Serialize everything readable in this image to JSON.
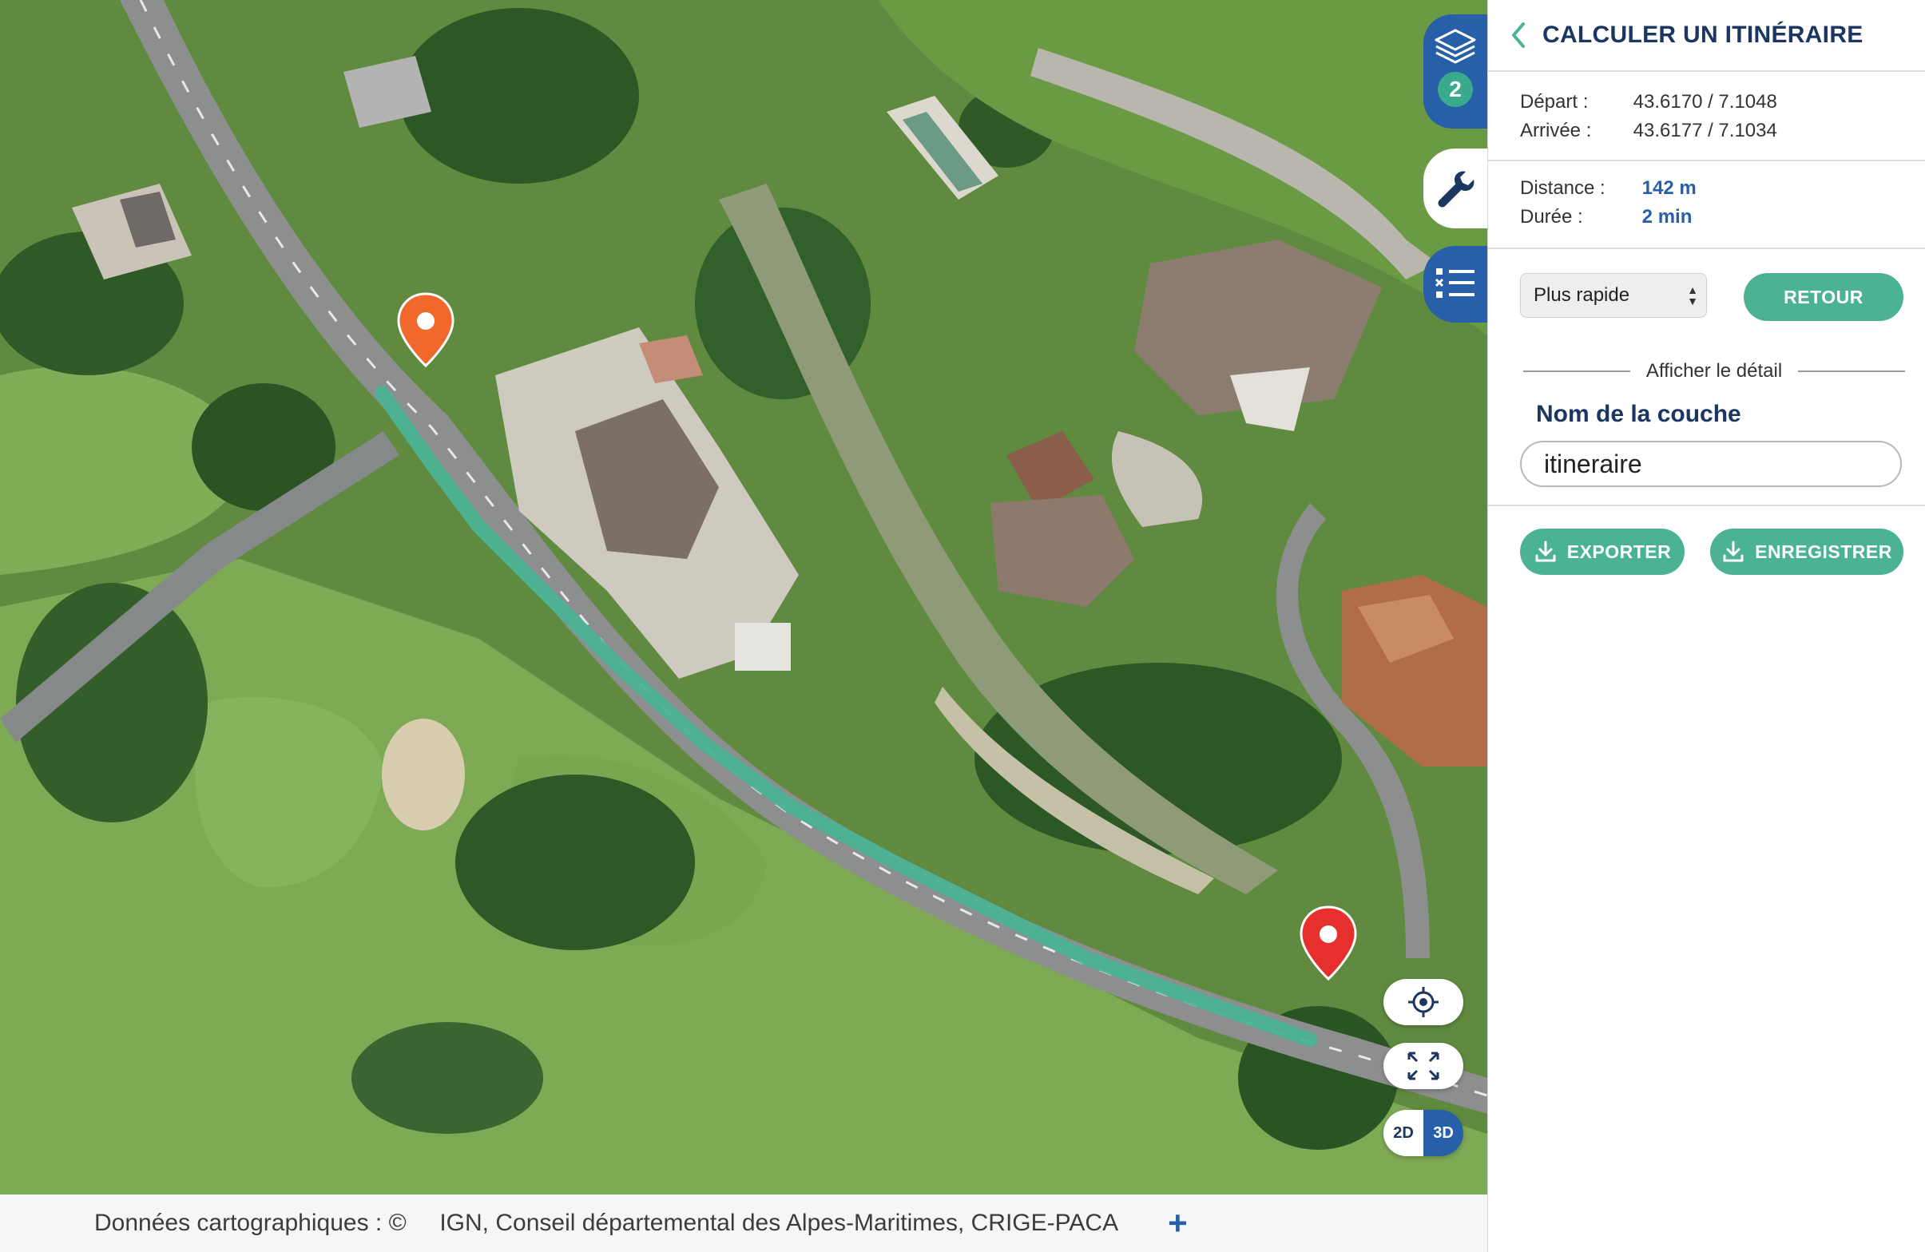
{
  "map": {
    "route_color": "#4bb394",
    "start_marker_icon": "map-pin-orange",
    "end_marker_icon": "map-pin-red"
  },
  "toolbar": {
    "layers_count": "2",
    "layers_icon": "layers-stack-icon",
    "tools_icon": "wrench-icon",
    "legend_icon": "legend-list-icon"
  },
  "controls": {
    "locate_icon": "crosshair-icon",
    "fullscreen_icon": "expand-arrows-icon",
    "dim_2d": "2D",
    "dim_3d": "3D",
    "active_dimension": "3D"
  },
  "attribution": {
    "text": "Données cartographiques : ©     IGN, Conseil départemental des Alpes-Maritimes, CRIGE-PACA",
    "plus": "+"
  },
  "panel": {
    "title": "CALCULER UN ITINÉRAIRE",
    "departure_label": "Départ :",
    "departure_value": "43.6170 / 7.1048",
    "arrival_label": "Arrivée :",
    "arrival_value": "43.6177 / 7.1034",
    "distance_label": "Distance :",
    "distance_value": "142 m",
    "duration_label": "Durée :",
    "duration_value": "2 min",
    "mode_select_value": "Plus rapide",
    "retour_button": "RETOUR",
    "detail_label": "Afficher le détail",
    "layer_name_label": "Nom de la couche",
    "layer_name_value": "itineraire",
    "export_button": "EXPORTER",
    "save_button": "ENREGISTRER",
    "accent_color": "#4bb394",
    "title_color": "#1b3660"
  }
}
